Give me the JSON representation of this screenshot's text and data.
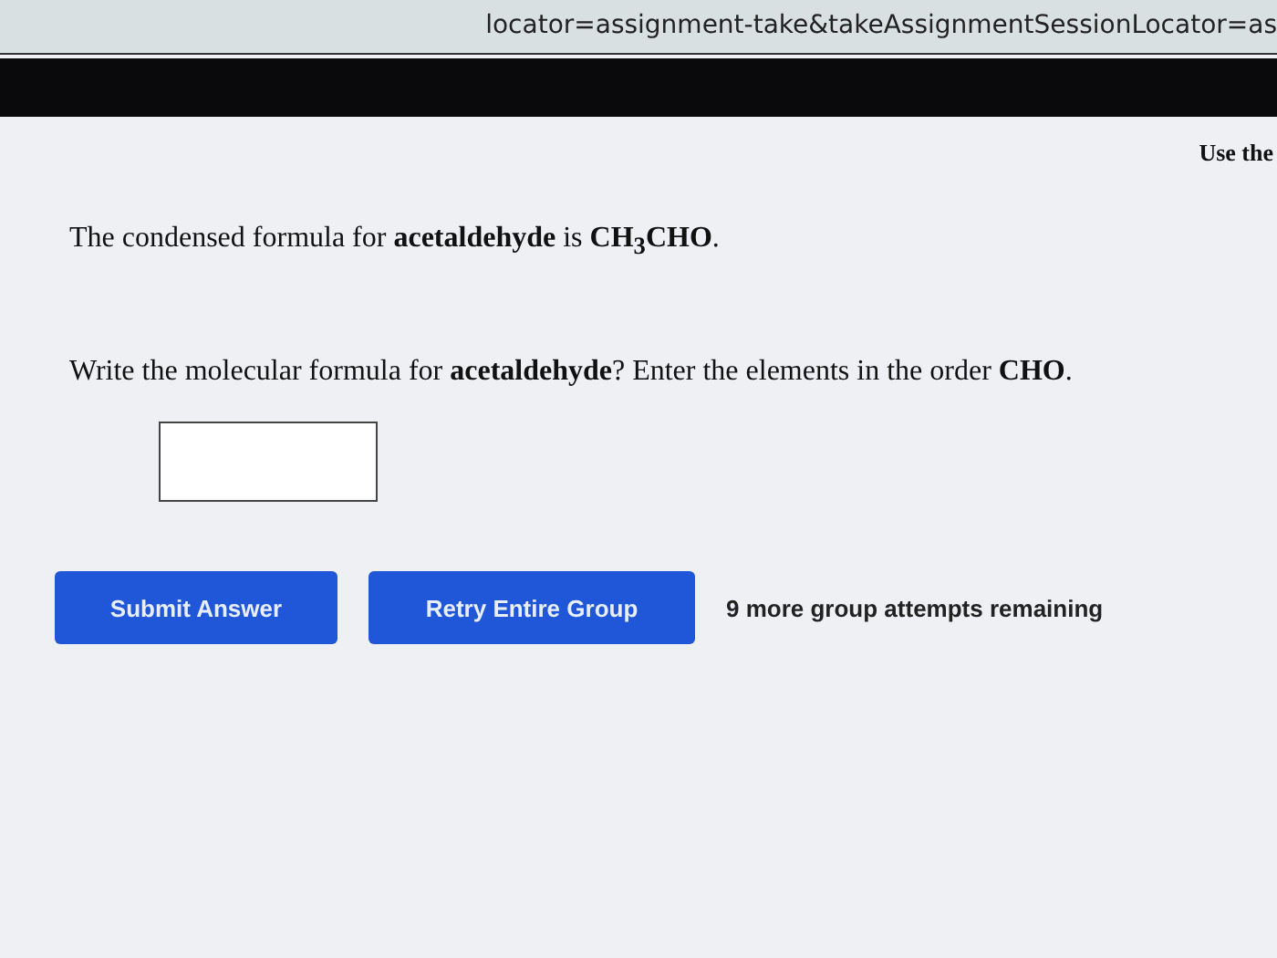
{
  "address_bar": {
    "url": "locator=assignment-take&takeAssignmentSessionLocator=as"
  },
  "side_note": "Use the",
  "question": {
    "statement": "The condensed formula for **acetaldehyde** is **CH$_{3}$CHO**.",
    "prompt": "Write the molecular formula for **acetaldehyde**? Enter the elements in the order **CHO**."
  },
  "buttons": [
    "Submit Answer",
    "Retry Entire Group"
  ],
  "attempts": "9 more group attempts remaining"
}
